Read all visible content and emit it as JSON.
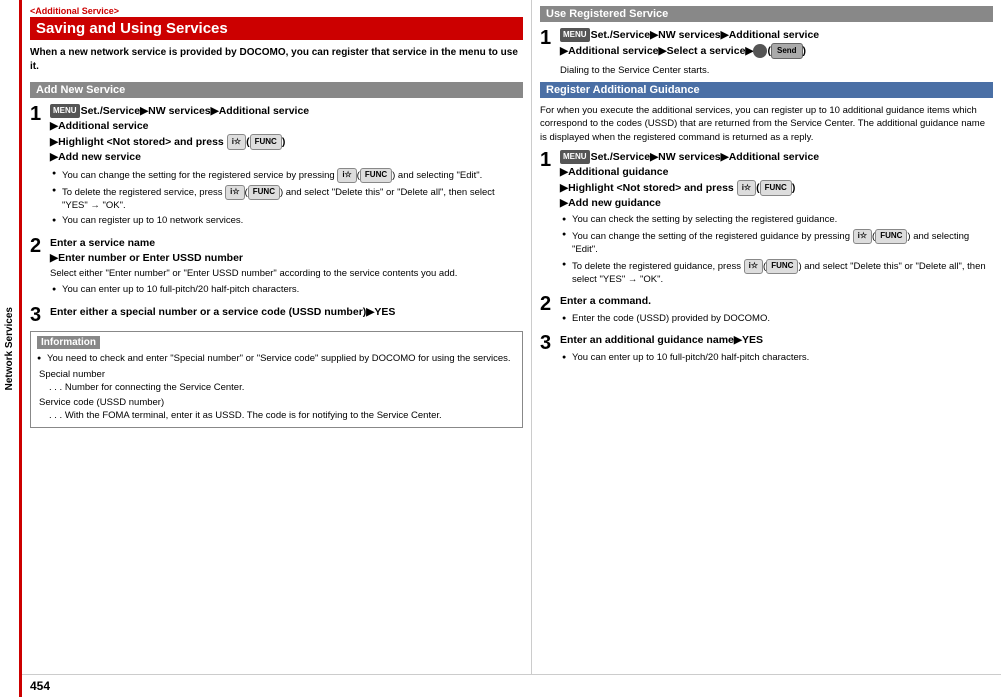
{
  "sidebar": {
    "label": "Network Services"
  },
  "left": {
    "breadcrumb": "<Additional Service>",
    "title": "Saving and Using Services",
    "intro": "When a new network service is provided by DOCOMO, you can register that service in the menu to use it.",
    "add_new_service": "Add New Service",
    "steps": [
      {
        "number": "1",
        "line1": "Set./Service▶NW services▶Additional service",
        "line2": "▶Additional service",
        "line3": "▶Highlight <Not stored> and press ",
        "line3b": "(     )",
        "line4": "▶Add new service",
        "bullets": [
          "You can change the setting for the registered service by pressing      (      ) and selecting \"Edit\".",
          "To delete the registered service, press      (      ) and select \"Delete this\" or \"Delete all\", then select \"YES\" → \"OK\".",
          "You can register up to 10 network services."
        ]
      },
      {
        "number": "2",
        "line1": "Enter a service name",
        "line2": "▶Enter number or Enter USSD number",
        "desc": "Select either \"Enter number\" or \"Enter USSD number\" according to the service contents you add.",
        "bullets": [
          "You can enter up to 10 full-pitch/20 half-pitch characters."
        ]
      },
      {
        "number": "3",
        "line1": "Enter either a special number or a service code (USSD number)▶YES"
      }
    ],
    "information": {
      "header": "Information",
      "items": [
        "You need to check and enter \"Special number\" or \"Service code\" supplied by DOCOMO for using the services.",
        "Special number",
        ". . .  Number for connecting the Service Center.",
        "Service code (USSD number)",
        ". . .  With the FOMA terminal, enter it as USSD. The code is for notifying to the Service Center."
      ]
    }
  },
  "right": {
    "use_registered": {
      "header": "Use Registered Service",
      "step1": {
        "number": "1",
        "line1": "Set./Service▶NW services▶Additional service",
        "line2": "▶Additional service▶Select a service▶  (     )"
      },
      "dialing_note": "Dialing to the Service Center starts."
    },
    "register_guidance": {
      "header": "Register Additional Guidance",
      "intro": "For when you execute the additional services, you can register up to 10 additional guidance items which correspond to the codes (USSD) that are returned from the Service Center. The additional guidance name is displayed when the registered command is returned as a reply.",
      "steps": [
        {
          "number": "1",
          "line1": "Set./Service▶NW services▶Additional service",
          "line2": "▶Additional guidance",
          "line3": "▶Highlight <Not stored> and press ",
          "line3b": "(     )",
          "line4": "▶Add new guidance",
          "bullets": [
            "You can check the setting by selecting the registered guidance.",
            "You can change the setting of the registered guidance by pressing      (      ) and selecting \"Edit\".",
            "To delete the registered guidance, press      (      ) and select \"Delete this\" or \"Delete all\", then select \"YES\" → \"OK\"."
          ]
        },
        {
          "number": "2",
          "line1": "Enter a command.",
          "bullets": [
            "Enter the code (USSD) provided by DOCOMO."
          ]
        },
        {
          "number": "3",
          "line1": "Enter an additional guidance name▶YES",
          "bullets": [
            "You can enter up to 10 full-pitch/20 half-pitch characters."
          ]
        }
      ]
    }
  },
  "page_number": "454"
}
